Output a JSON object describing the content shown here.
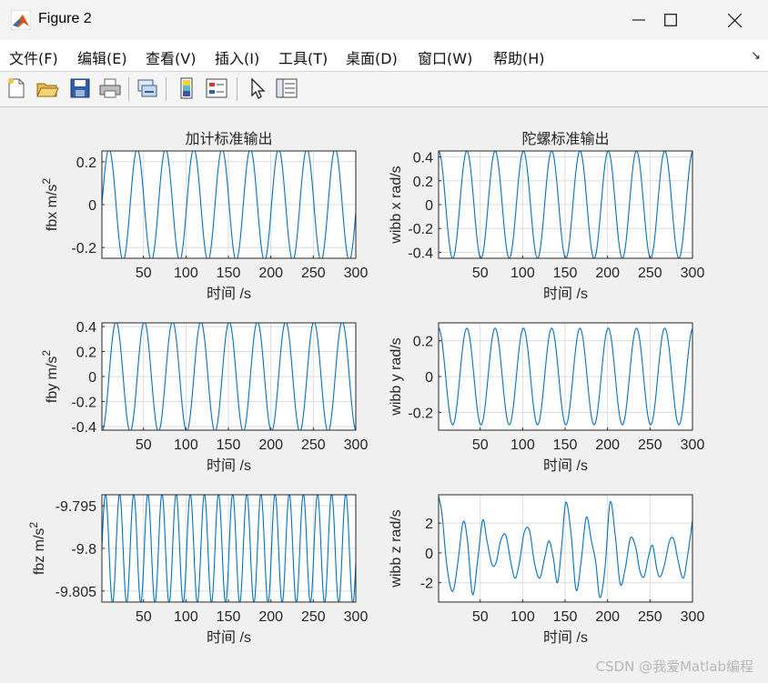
{
  "window": {
    "title": "Figure 2"
  },
  "menu": {
    "items": [
      "文件(F)",
      "编辑(E)",
      "查看(V)",
      "插入(I)",
      "工具(T)",
      "桌面(D)",
      "窗口(W)",
      "帮助(H)"
    ]
  },
  "toolbar": {
    "icons": [
      "new-figure-icon",
      "open-file-icon",
      "save-icon",
      "print-icon",
      "link-plot-icon",
      "insert-colorbar-icon",
      "insert-legend-icon",
      "edit-plot-pointer-icon",
      "property-inspector-icon"
    ]
  },
  "colors": {
    "line": "#0072bd",
    "grid": "#dcdcdc",
    "axes_bg": "#ffffff"
  },
  "watermark": "CSDN @我爱Matlab编程",
  "chart_data": [
    {
      "type": "line",
      "title": "加计标准输出",
      "xlabel": "时间 /s",
      "ylabel": "fbx m/s²",
      "ylabel_base": "fbx m/s",
      "ylabel_sup": "2",
      "xlim": [
        1,
        300
      ],
      "ylim": [
        -0.25,
        0.25
      ],
      "xticks": [
        "50",
        "100",
        "150",
        "200",
        "250",
        "300"
      ],
      "xtick_values": [
        50,
        100,
        150,
        200,
        250,
        300
      ],
      "yticks": [
        "0.2",
        "0",
        "-0.2"
      ],
      "ytick_values": [
        0.2,
        0,
        -0.2
      ],
      "grid": true,
      "series": [
        {
          "amplitude": 0.26,
          "period": 33.3,
          "phase_deg": 0,
          "offset": 0
        }
      ]
    },
    {
      "type": "line",
      "title": "陀螺标准输出",
      "xlabel": "时间 /s",
      "ylabel": "wibb x rad/s",
      "xlim": [
        1,
        300
      ],
      "ylim": [
        -0.45,
        0.45
      ],
      "xticks": [
        "50",
        "100",
        "150",
        "200",
        "250",
        "300"
      ],
      "xtick_values": [
        50,
        100,
        150,
        200,
        250,
        300
      ],
      "yticks": [
        "0.4",
        "0.2",
        "0",
        "-0.2",
        "-0.4"
      ],
      "ytick_values": [
        0.4,
        0.2,
        0,
        -0.2,
        -0.4
      ],
      "grid": true,
      "series": [
        {
          "amplitude": 0.45,
          "period": 33.3,
          "phase_deg": 90,
          "offset": 0
        }
      ]
    },
    {
      "type": "line",
      "title": "",
      "xlabel": "时间 /s",
      "ylabel": "fby m/s²",
      "ylabel_base": "fby m/s",
      "ylabel_sup": "2",
      "xlim": [
        1,
        300
      ],
      "ylim": [
        -0.43,
        0.43
      ],
      "xticks": [
        "50",
        "100",
        "150",
        "200",
        "250",
        "300"
      ],
      "xtick_values": [
        50,
        100,
        150,
        200,
        250,
        300
      ],
      "yticks": [
        "0.4",
        "0.2",
        "0",
        "-0.2",
        "-0.4"
      ],
      "ytick_values": [
        0.4,
        0.2,
        0,
        -0.2,
        -0.4
      ],
      "grid": true,
      "series": [
        {
          "amplitude": 0.44,
          "period": 33.3,
          "phase_deg": -90,
          "offset": 0
        }
      ]
    },
    {
      "type": "line",
      "title": "",
      "xlabel": "时间 /s",
      "ylabel": "wibb y rad/s",
      "xlim": [
        1,
        300
      ],
      "ylim": [
        -0.3,
        0.3
      ],
      "xticks": [
        "50",
        "100",
        "150",
        "200",
        "250",
        "300"
      ],
      "xtick_values": [
        50,
        100,
        150,
        200,
        250,
        300
      ],
      "yticks": [
        "0.2",
        "0",
        "-0.2"
      ],
      "ytick_values": [
        0.2,
        0,
        -0.2
      ],
      "grid": true,
      "series": [
        {
          "amplitude": 0.27,
          "period": 33.3,
          "phase_deg": 90,
          "offset": 0
        }
      ]
    },
    {
      "type": "line",
      "title": "",
      "xlabel": "时间 /s",
      "ylabel": "fbz m/s²",
      "ylabel_base": "fbz m/s",
      "ylabel_sup": "2",
      "xlim": [
        1,
        300
      ],
      "ylim": [
        -9.8063,
        -9.7937
      ],
      "xticks": [
        "50",
        "100",
        "150",
        "200",
        "250",
        "300"
      ],
      "xtick_values": [
        50,
        100,
        150,
        200,
        250,
        300
      ],
      "yticks": [
        "-9.795",
        "-9.8",
        "-9.805"
      ],
      "ytick_values": [
        -9.795,
        -9.8,
        -9.805
      ],
      "grid": true,
      "series": [
        {
          "amplitude": 0.0064,
          "period": 16.65,
          "phase_deg": 0,
          "offset": -9.8
        }
      ]
    },
    {
      "type": "line",
      "title": "",
      "xlabel": "时间 /s",
      "ylabel": "wibb z rad/s",
      "xlim": [
        1,
        300
      ],
      "ylim": [
        -3.3,
        3.9
      ],
      "xticks": [
        "50",
        "100",
        "150",
        "200",
        "250",
        "300"
      ],
      "xtick_values": [
        50,
        100,
        150,
        200,
        250,
        300
      ],
      "yticks": [
        "2",
        "0",
        "-2"
      ],
      "ytick_values": [
        2,
        0,
        -2
      ],
      "grid": true,
      "series": [
        {
          "points": [
            [
              1,
              3.8
            ],
            [
              5,
              2.6
            ],
            [
              10,
              -0.5
            ],
            [
              15,
              -2.3
            ],
            [
              19,
              -2.4
            ],
            [
              24,
              -0.5
            ],
            [
              30,
              2.1
            ],
            [
              35,
              0.8
            ],
            [
              41,
              -2.8
            ],
            [
              47,
              -0.5
            ],
            [
              53,
              2.2
            ],
            [
              58,
              0.8
            ],
            [
              64,
              -0.8
            ],
            [
              69,
              -0.6
            ],
            [
              74,
              0.8
            ],
            [
              80,
              1.2
            ],
            [
              86,
              -0.6
            ],
            [
              91,
              -1.7
            ],
            [
              96,
              -0.7
            ],
            [
              102,
              1.4
            ],
            [
              108,
              1.5
            ],
            [
              114,
              -0.7
            ],
            [
              120,
              -1.7
            ],
            [
              126,
              -0.3
            ],
            [
              131,
              0.8
            ],
            [
              136,
              -0.3
            ],
            [
              141,
              -2.0
            ],
            [
              146,
              0.5
            ],
            [
              151,
              3.4
            ],
            [
              157,
              1.3
            ],
            [
              163,
              -2.5
            ],
            [
              169,
              -0.5
            ],
            [
              175,
              2.4
            ],
            [
              181,
              0.8
            ],
            [
              186,
              -0.6
            ],
            [
              191,
              -3.0
            ],
            [
              197,
              -1.0
            ],
            [
              203,
              3.4
            ],
            [
              209,
              1.2
            ],
            [
              215,
              -2.1
            ],
            [
              221,
              -1.0
            ],
            [
              227,
              1.0
            ],
            [
              233,
              0.4
            ],
            [
              238,
              -1.2
            ],
            [
              243,
              -1.6
            ],
            [
              248,
              -0.3
            ],
            [
              253,
              0.5
            ],
            [
              258,
              -1.1
            ],
            [
              262,
              -1.6
            ],
            [
              267,
              -0.8
            ],
            [
              273,
              0.8
            ],
            [
              278,
              0.9
            ],
            [
              283,
              -0.5
            ],
            [
              289,
              -1.7
            ],
            [
              294,
              -0.3
            ],
            [
              300,
              2.2
            ]
          ]
        }
      ]
    }
  ]
}
